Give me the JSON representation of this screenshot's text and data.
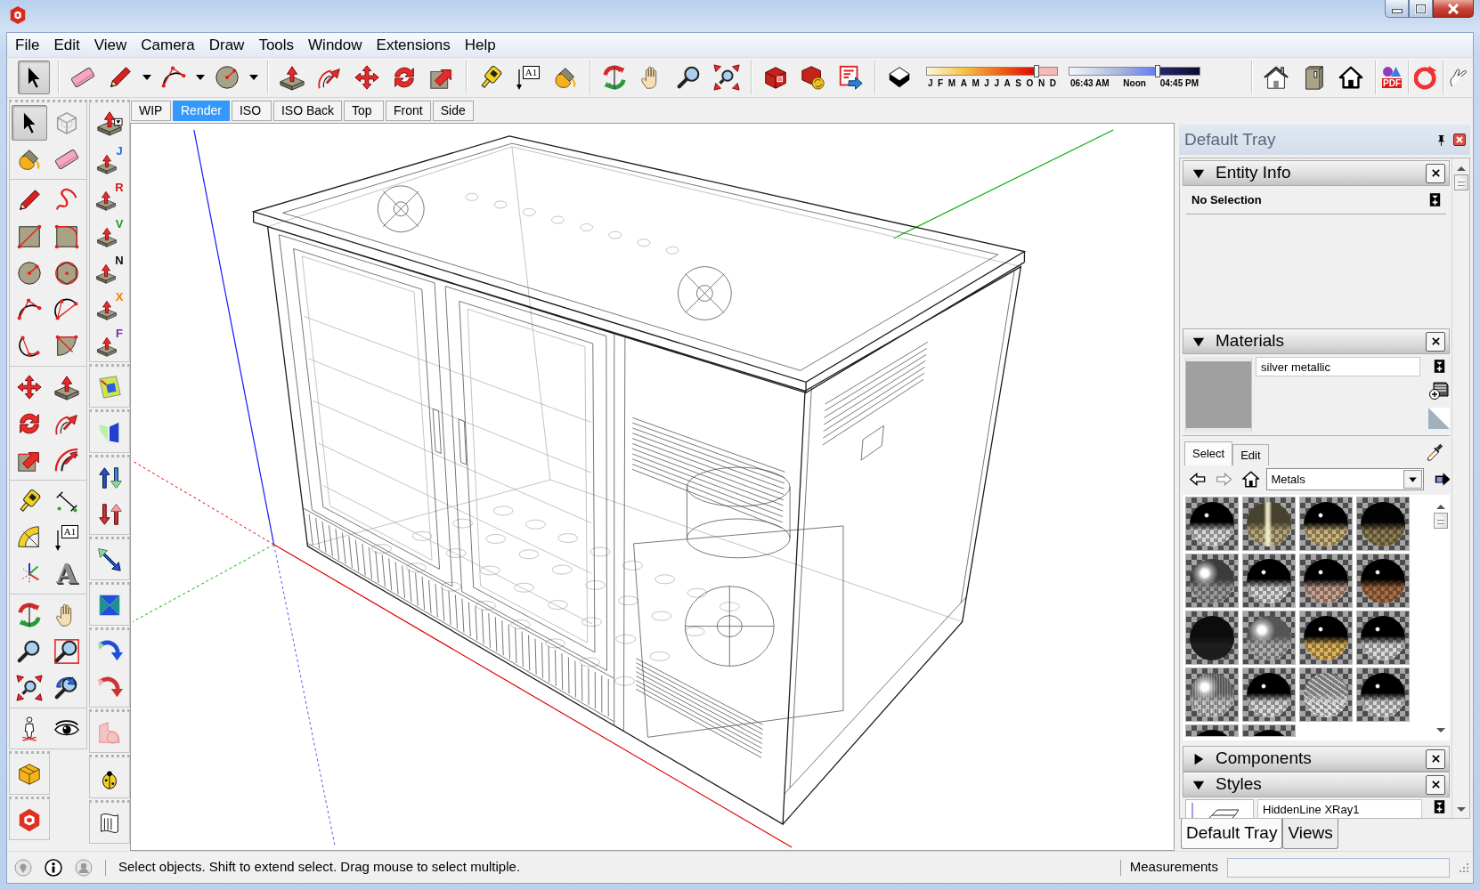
{
  "menu": [
    "File",
    "Edit",
    "View",
    "Camera",
    "Draw",
    "Tools",
    "Window",
    "Extensions",
    "Help"
  ],
  "toolbar": {
    "groups": [
      [
        {
          "kind": "select",
          "selected": true
        }
      ],
      [
        {
          "kind": "eraser",
          "selected": false
        },
        {
          "kind": "pencil",
          "selected": false
        },
        {
          "kind": "caret",
          "selected": false
        },
        {
          "kind": "arc",
          "selected": false
        },
        {
          "kind": "caret",
          "selected": false
        },
        {
          "kind": "circle",
          "selected": false
        },
        {
          "kind": "caret",
          "selected": false
        }
      ],
      [
        {
          "kind": "push_pull",
          "selected": false
        },
        {
          "kind": "follow_me",
          "selected": false
        },
        {
          "kind": "move",
          "selected": false
        },
        {
          "kind": "rotate",
          "selected": false
        },
        {
          "kind": "scale",
          "selected": false
        }
      ],
      [
        {
          "kind": "tape",
          "selected": false
        },
        {
          "kind": "text",
          "label": "A1",
          "selected": false
        },
        {
          "kind": "paint",
          "selected": false
        }
      ],
      [
        {
          "kind": "orbit",
          "selected": false
        },
        {
          "kind": "pan",
          "selected": false
        },
        {
          "kind": "zoom",
          "selected": false
        },
        {
          "kind": "zoom_extents",
          "selected": false
        }
      ],
      [
        {
          "kind": "warehouse",
          "selected": false
        },
        {
          "kind": "share_model",
          "selected": false
        },
        {
          "kind": "extension_warehouse",
          "selected": false
        }
      ],
      [
        {
          "kind": "shadows",
          "selected": false
        },
        {
          "kind": "month_slider",
          "level": 0.84,
          "labels": [
            "J",
            "F",
            "M",
            "A",
            "M",
            "J",
            "J",
            "A",
            "S",
            "O",
            "N",
            "D"
          ]
        },
        {
          "kind": "time_slider",
          "level": 0.68,
          "labels": [
            "06:43 AM",
            "Noon",
            "04:45 PM"
          ]
        }
      ],
      [
        {
          "kind": "house",
          "selected": false
        },
        {
          "kind": "door_panel",
          "selected": false
        },
        {
          "kind": "home",
          "selected": false
        }
      ],
      [
        {
          "kind": "pdf",
          "label": "PDF",
          "selected": false
        }
      ],
      [
        {
          "kind": "ring",
          "selected": false
        }
      ],
      [
        {
          "kind": "sketch_hand",
          "selected": false
        }
      ]
    ]
  },
  "scene_tabs": [
    {
      "label": "WIP",
      "selected": false
    },
    {
      "label": "Render",
      "selected": true
    },
    {
      "label": "ISO",
      "selected": false
    },
    {
      "label": "ISO Back",
      "selected": false
    },
    {
      "label": "Top",
      "selected": false
    },
    {
      "label": "Front",
      "selected": false
    },
    {
      "label": "Side",
      "selected": false
    }
  ],
  "left_toolbars": [
    {
      "toolbars": [
        {
          "groups": [
            [
              {
                "kind": "select",
                "selected": true
              },
              {
                "kind": "component",
                "selected": false
              },
              {
                "kind": "paint",
                "selected": false
              },
              {
                "kind": "eraser",
                "selected": false
              }
            ],
            [
              {
                "kind": "pencil",
                "selected": false
              },
              {
                "kind": "freehand",
                "selected": false
              },
              {
                "kind": "rectangle",
                "selected": false
              },
              {
                "kind": "rotated_rectangle",
                "selected": false
              },
              {
                "kind": "circle",
                "selected": false
              },
              {
                "kind": "polygon",
                "selected": false
              },
              {
                "kind": "arc",
                "selected": false
              },
              {
                "kind": "two_point_arc",
                "selected": false
              },
              {
                "kind": "three_point_arc",
                "selected": false
              },
              {
                "kind": "pie",
                "selected": false
              }
            ],
            [
              {
                "kind": "move",
                "selected": false
              },
              {
                "kind": "push_pull",
                "selected": false
              },
              {
                "kind": "rotate",
                "selected": false
              },
              {
                "kind": "follow_me",
                "selected": false
              },
              {
                "kind": "scale",
                "selected": false
              },
              {
                "kind": "offset",
                "selected": false
              }
            ],
            [
              {
                "kind": "tape",
                "selected": false
              },
              {
                "kind": "dimension",
                "selected": false
              },
              {
                "kind": "protractor",
                "selected": false
              },
              {
                "kind": "text",
                "label": "A1",
                "selected": false
              },
              {
                "kind": "axes",
                "selected": false
              },
              {
                "kind": "text_3d",
                "label": "A",
                "selected": false
              }
            ],
            [
              {
                "kind": "orbit",
                "selected": false
              },
              {
                "kind": "pan",
                "selected": false
              },
              {
                "kind": "zoom",
                "selected": false
              },
              {
                "kind": "zoom_window",
                "selected": false
              },
              {
                "kind": "zoom_extents",
                "selected": false
              },
              {
                "kind": "previous",
                "selected": false
              }
            ],
            [
              {
                "kind": "walk",
                "selected": false
              },
              {
                "kind": "look_around",
                "selected": false
              }
            ]
          ]
        },
        {
          "groups": [
            [
              {
                "kind": "sandbox",
                "selected": false
              }
            ]
          ]
        },
        {
          "groups": [
            [
              {
                "kind": "logo",
                "selected": false
              }
            ]
          ]
        }
      ]
    },
    {
      "toolbars": [
        {
          "groups": [
            [
              {
                "kind": "pushpull_menu",
                "selected": false
              },
              {
                "kind": "pushpull_letter",
                "label": "J",
                "color": "#1a73e8",
                "selected": false
              },
              {
                "kind": "pushpull_letter",
                "label": "R",
                "color": "#e01010",
                "selected": false
              },
              {
                "kind": "pushpull_letter",
                "label": "V",
                "color": "#1f9a1f",
                "selected": false
              },
              {
                "kind": "pushpull_letter",
                "label": "N",
                "color": "#111111",
                "selected": false
              },
              {
                "kind": "pushpull_letter",
                "label": "X",
                "color": "#f08000",
                "selected": false
              },
              {
                "kind": "pushpull_letter",
                "label": "F",
                "color": "#8020c0",
                "selected": false
              }
            ]
          ]
        },
        {
          "groups": [
            [
              {
                "kind": "color_square",
                "selected": false
              }
            ]
          ]
        },
        {
          "groups": [
            [
              {
                "kind": "trapezoid",
                "selected": false
              }
            ]
          ]
        },
        {
          "groups": [
            [
              {
                "kind": "arrows_blue",
                "selected": false
              },
              {
                "kind": "arrows_red",
                "selected": false
              }
            ]
          ]
        },
        {
          "groups": [
            [
              {
                "kind": "diagonal_arrow",
                "selected": false
              }
            ]
          ]
        },
        {
          "groups": [
            [
              {
                "kind": "hourglass",
                "selected": false
              }
            ]
          ]
        },
        {
          "groups": [
            [
              {
                "kind": "curve_blue",
                "selected": false
              },
              {
                "kind": "curve_red",
                "selected": false
              }
            ]
          ]
        },
        {
          "groups": [
            [
              {
                "kind": "protractor_pink",
                "selected": false
              }
            ]
          ]
        },
        {
          "groups": [
            [
              {
                "kind": "ladybug",
                "selected": false
              }
            ]
          ]
        },
        {
          "groups": [
            [
              {
                "kind": "scroll",
                "selected": false
              }
            ]
          ]
        }
      ]
    }
  ],
  "tray": {
    "title": "Default Tray",
    "panels": [
      {
        "kind": "entity_info",
        "title": "Entity Info",
        "expanded": true,
        "selection": "No Selection"
      },
      {
        "kind": "materials",
        "title": "Materials",
        "expanded": true,
        "material_name": "silver metallic",
        "tabs": [
          {
            "label": "Select",
            "selected": true
          },
          {
            "label": "Edit",
            "selected": false
          }
        ],
        "library": "Metals",
        "thumbnails": [
          {
            "kind": "chrome"
          },
          {
            "kind": "brushed_gold"
          },
          {
            "kind": "gold"
          },
          {
            "kind": "dark_gold"
          },
          {
            "kind": "steel"
          },
          {
            "kind": "chrome"
          },
          {
            "kind": "rose"
          },
          {
            "kind": "copper"
          },
          {
            "kind": "black"
          },
          {
            "kind": "satin"
          },
          {
            "kind": "yellow_gold"
          },
          {
            "kind": "chrome"
          },
          {
            "kind": "brushed_steel"
          },
          {
            "kind": "chrome"
          },
          {
            "kind": "hammered"
          },
          {
            "kind": "chrome"
          },
          {
            "kind": "chrome"
          },
          {
            "kind": "chrome"
          }
        ]
      },
      {
        "title": "Components",
        "expanded": false
      },
      {
        "kind": "styles",
        "title": "Styles",
        "expanded": true,
        "style_name": "HiddenLine XRay1"
      }
    ],
    "tabs": [
      {
        "label": "Default Tray",
        "selected": true
      },
      {
        "label": "Views",
        "selected": false
      }
    ]
  },
  "status_bar": {
    "hint": "Select objects. Shift to extend select. Drag mouse to select multiple.",
    "measurements_label": "Measurements"
  }
}
